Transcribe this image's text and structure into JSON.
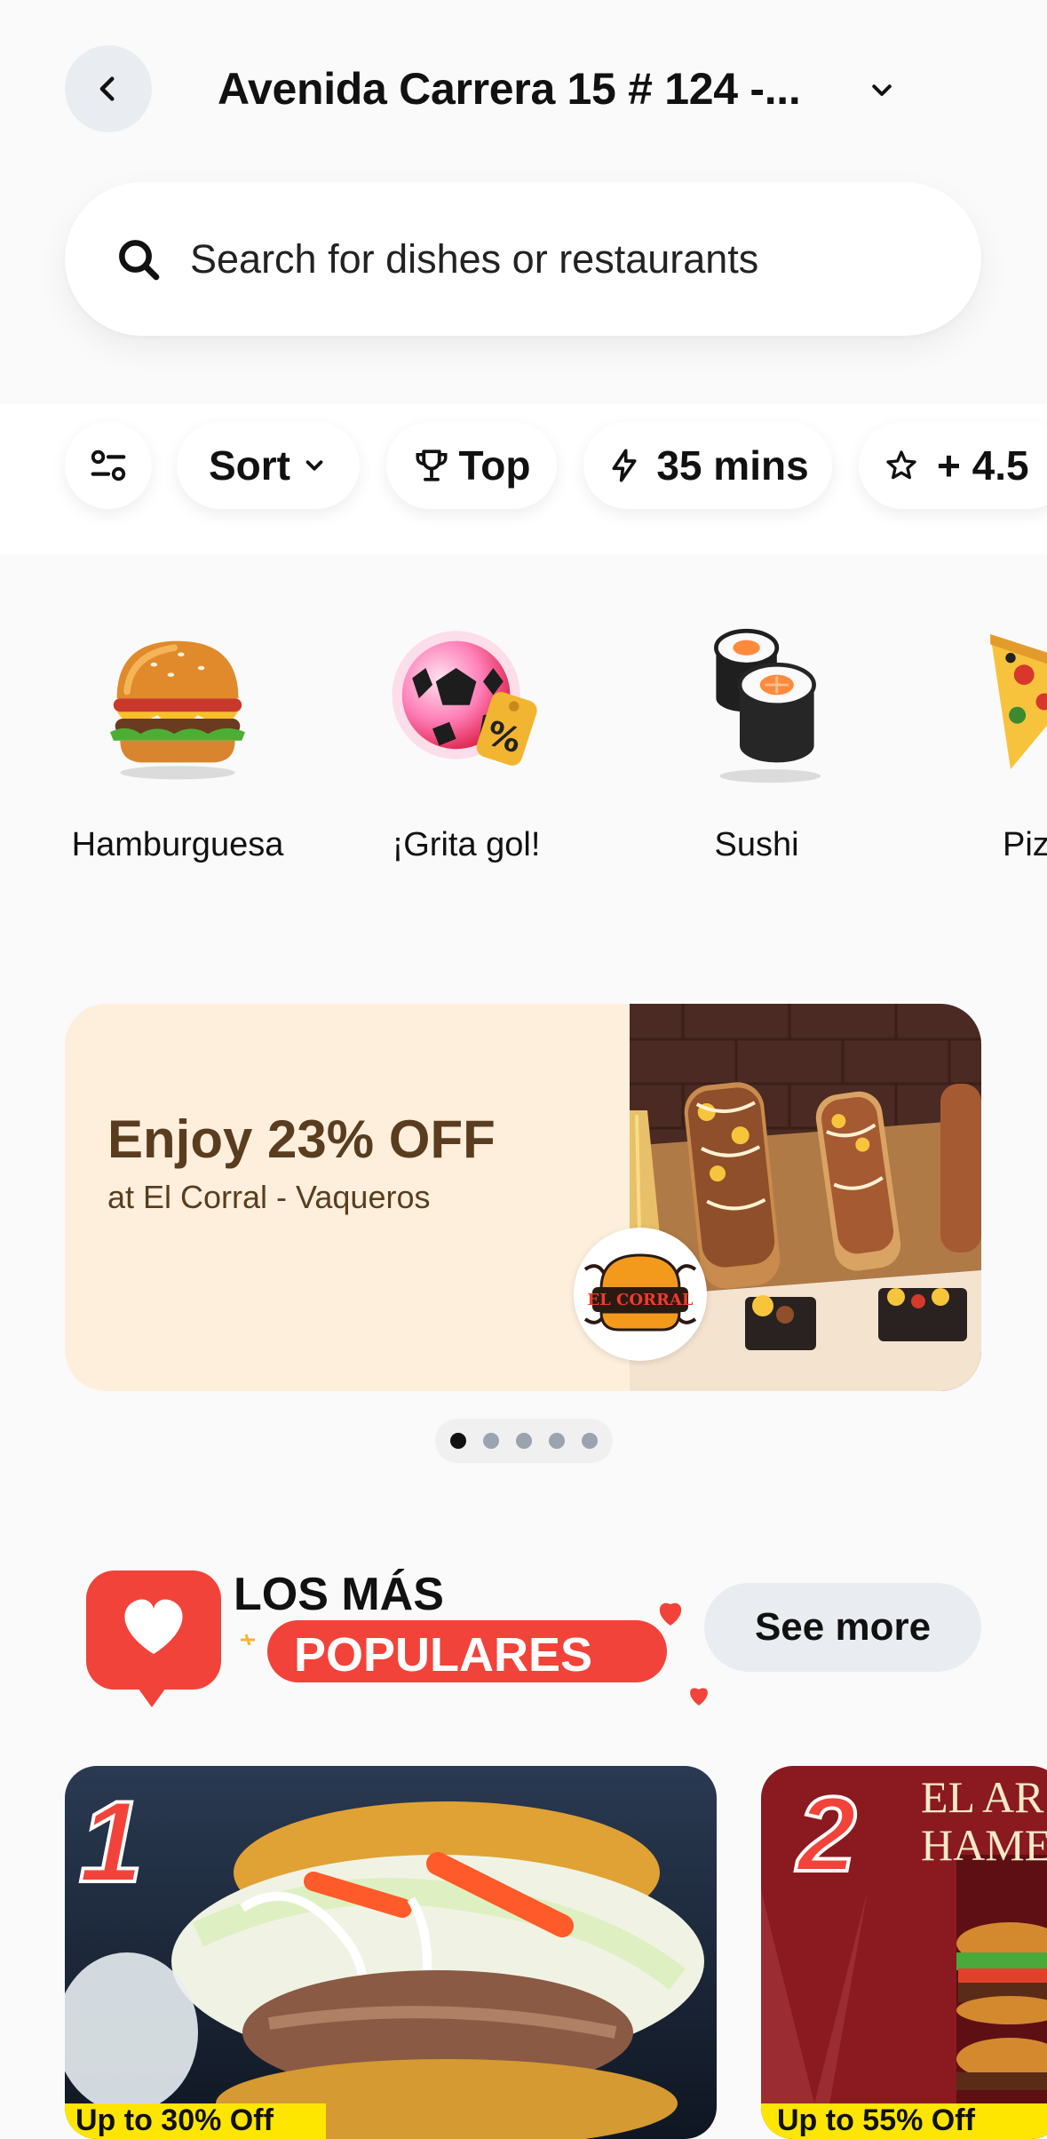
{
  "header": {
    "address": "Avenida Carrera 15 # 124 -...",
    "back_icon": "chevron-left-icon",
    "dropdown_icon": "chevron-down-icon"
  },
  "search": {
    "placeholder": "Search for dishes or restaurants",
    "value": "",
    "icon": "search-icon"
  },
  "filters": {
    "adjust_icon": "sliders-icon",
    "sort_label": "Sort",
    "top_label": "Top",
    "time_label": "35 mins",
    "rating_label": "+ 4.5"
  },
  "categories": [
    {
      "label": "Hamburguesa",
      "icon": "burger-icon"
    },
    {
      "label": "¡Grita gol!",
      "icon": "soccer-ball-discount-icon"
    },
    {
      "label": "Sushi",
      "icon": "sushi-icon"
    },
    {
      "label": "Piz",
      "icon": "pizza-icon"
    }
  ],
  "banner": {
    "title": "Enjoy 23% OFF",
    "subtitle": "at El Corral - Vaqueros",
    "logo_text": "EL CORRAL",
    "active_dot": 1,
    "dot_count": 5
  },
  "popular": {
    "title_line1": "LOS MÁS",
    "title_line2": "POPULARES",
    "see_more_label": "See more"
  },
  "cards": [
    {
      "rank": "1",
      "promo": "Up to 30% Off"
    },
    {
      "rank": "2",
      "headline_1": "EL AR",
      "headline_2": "HAME",
      "promo": "Up to 55% Off"
    }
  ],
  "colors": {
    "background": "#fafafa",
    "chip_bg": "#ffffff",
    "banner_bg": "#feefdd",
    "banner_text": "#5a3d1f",
    "brand_red": "#f2433a",
    "promo_yellow": "#ffe600",
    "button_gray": "#e9edf1"
  }
}
